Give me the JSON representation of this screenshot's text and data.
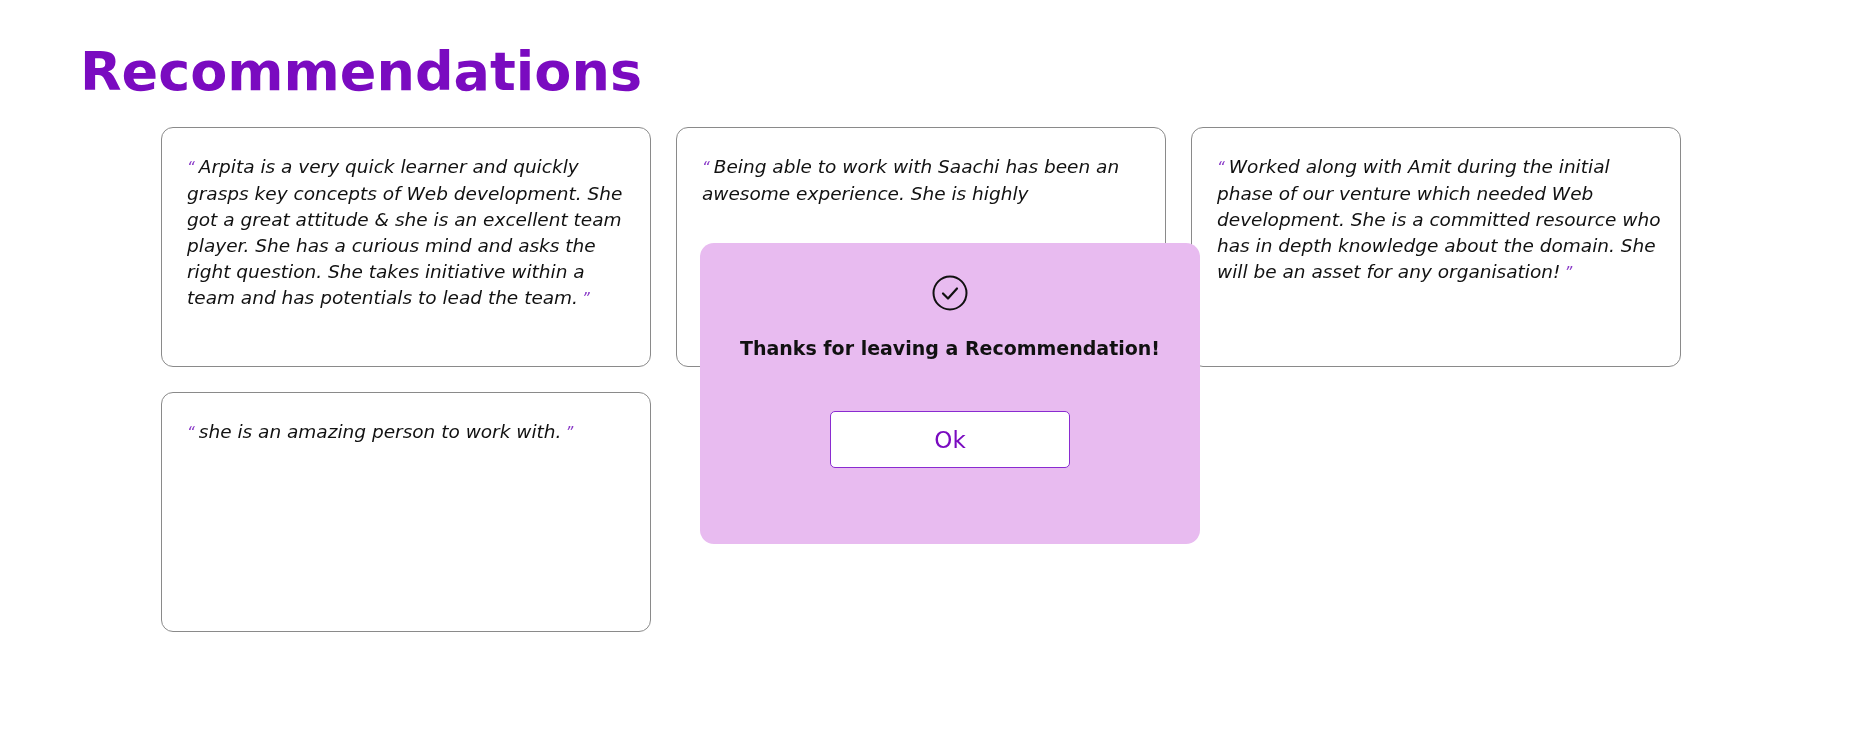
{
  "title": "Recommendations",
  "recommendations": [
    {
      "open_quote": "“",
      "text": "Arpita is a very quick learner and quickly grasps key concepts of Web development. She got a great attitude & she is an excellent team player. She has a curious mind and asks the right question. She takes initiative within a team and has potentials to lead the team.",
      "close_quote": "”"
    },
    {
      "open_quote": "“",
      "text": "Being able to work with Saachi has been an awesome experience. She is highly"
    },
    {
      "open_quote": "“",
      "text": "Worked along with Amit during the initial phase of our venture which needed Web development. She is a committed resource who has in depth knowledge about the domain. She will be an asset for any organisation!",
      "close_quote": "”"
    },
    {
      "open_quote": "“",
      "text": "she is an amazing person to work with.",
      "close_quote": "”"
    }
  ],
  "dialog": {
    "message": "Thanks for leaving a Recommendation!",
    "button": "Ok"
  }
}
